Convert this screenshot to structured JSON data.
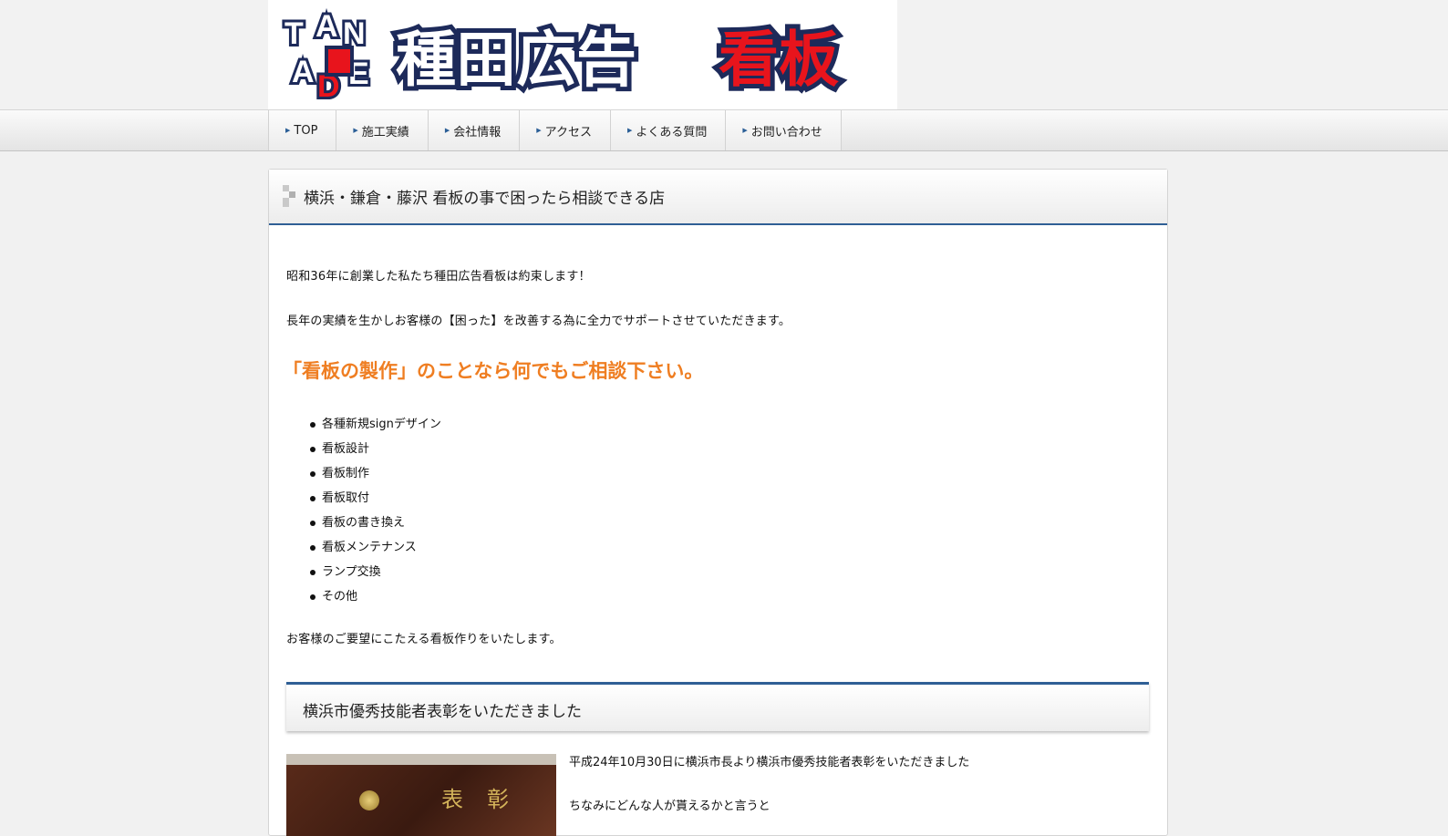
{
  "header": {
    "logo_alt": "種田広告看板",
    "logo_letters": [
      "T",
      "A",
      "N",
      "A",
      "D",
      "E"
    ],
    "logo_text_black": "種田広告",
    "logo_text_red": "看板"
  },
  "nav": {
    "items": [
      {
        "label": "TOP"
      },
      {
        "label": "施工実績"
      },
      {
        "label": "会社情報"
      },
      {
        "label": "アクセス"
      },
      {
        "label": "よくある質問"
      },
      {
        "label": "お問い合わせ"
      }
    ]
  },
  "main": {
    "title": "横浜・鎌倉・藤沢 看板の事で困ったら相談できる店",
    "intro1": "昭和36年に創業した私たち種田広告看板は約束します！",
    "intro2": "長年の実績を生かしお客様の【困った】を改善する為に全力でサポートさせていただきます。",
    "catch": "「看板の製作」のことなら何でもご相談下さい。",
    "services": [
      "各種新規signデザイン",
      "看板設計",
      "看板制作",
      "看板取付",
      "看板の書き換え",
      "看板メンテナンス",
      "ランプ交換",
      "その他"
    ],
    "closing": "お客様のご要望にこたえる看板作りをいたします。"
  },
  "award": {
    "title": "横浜市優秀技能者表彰をいただきました",
    "photo_plate_text": "表彰",
    "text1": "平成24年10月30日に横浜市長より横浜市優秀技能者表彰をいただきました",
    "text2": "ちなみにどんな人が貰えるかと言うと"
  },
  "colors": {
    "accent_blue": "#2f5f95",
    "catch_orange": "#ef7e22",
    "logo_red": "#e8141c",
    "logo_navy": "#1d2a5a"
  }
}
